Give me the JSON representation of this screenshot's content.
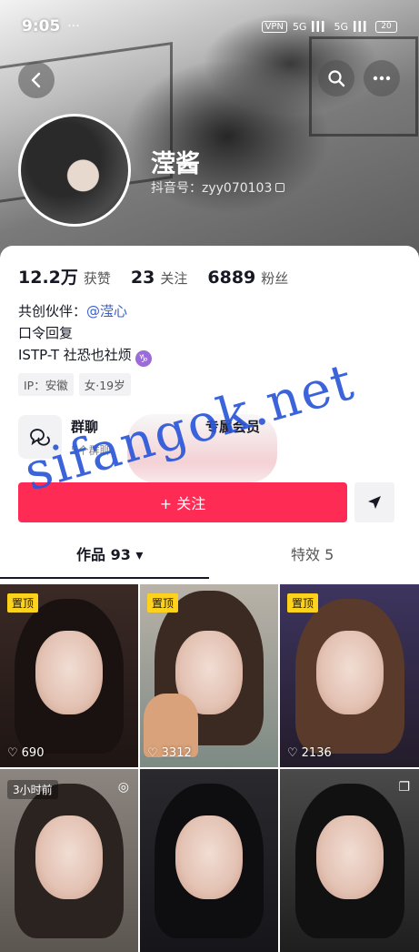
{
  "status_bar": {
    "time": "9:05",
    "dots": "···",
    "vpn": "VPN",
    "sig1": "5G",
    "sig2": "5G",
    "battery": "20"
  },
  "profile": {
    "nickname": "滢酱",
    "douyin_id": "抖音号：zyy070103"
  },
  "stats": [
    {
      "value": "12.2万",
      "label": "获赞"
    },
    {
      "value": "23",
      "label": "关注"
    },
    {
      "value": "6889",
      "label": "粉丝"
    }
  ],
  "bio": {
    "line1_prefix": "共创伙伴：",
    "line1_link": "@滢心",
    "line2": "口令回复",
    "line3": "ISTP-T 社恐也社烦",
    "zodiac": "♑"
  },
  "tags": [
    "IP：安徽",
    "女·19岁"
  ],
  "groups": {
    "title": "群聊",
    "subtitle": "5个群聊",
    "member_title": "专属会员"
  },
  "actions": {
    "follow": "+ 关注"
  },
  "tabs": {
    "works": "作品 93 ▾",
    "effects": "特效 5"
  },
  "grid": [
    {
      "badge": "置顶",
      "likes": "690"
    },
    {
      "badge": "置顶",
      "likes": "3312"
    },
    {
      "badge": "置顶",
      "likes": "2136"
    },
    {
      "badge": "3小时前",
      "likes": ""
    },
    {
      "badge": "",
      "likes": ""
    },
    {
      "badge": "",
      "likes": ""
    }
  ],
  "watermark": "sifangok.net",
  "colors": {
    "accent": "#fe2c55",
    "pin": "#fcd21c",
    "link": "#3a5fcd",
    "watermark": "#2b57d9"
  }
}
